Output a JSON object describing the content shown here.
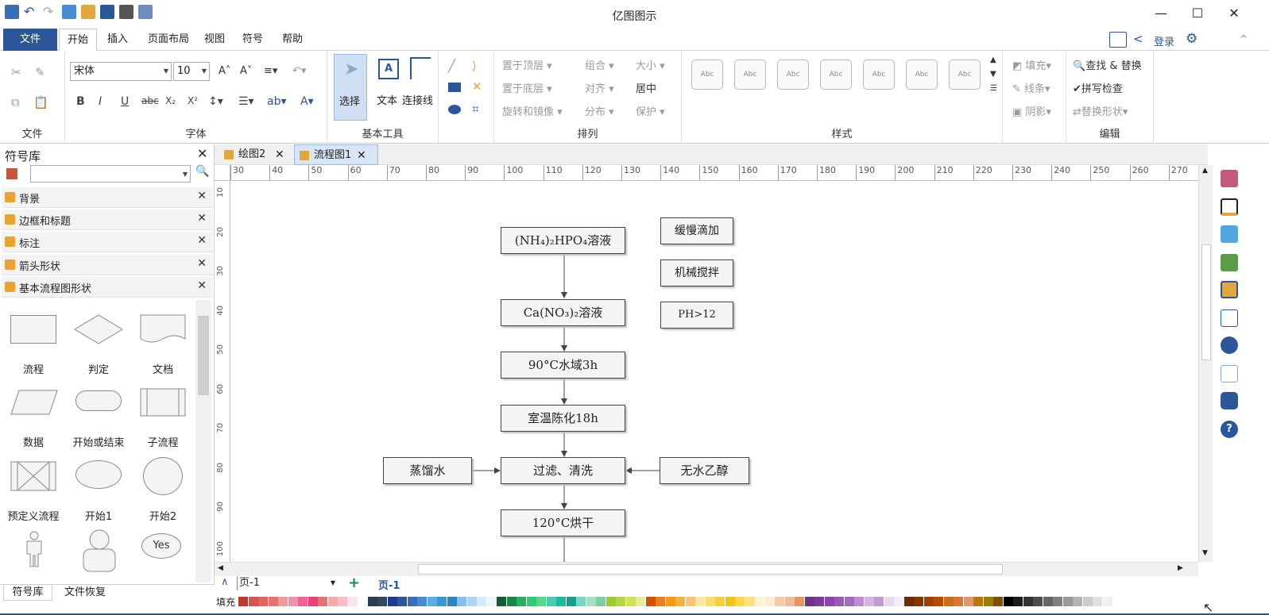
{
  "app": {
    "title": "亿图图示"
  },
  "window_controls": {
    "minimize": "—",
    "maximize": "☐",
    "close": "✕"
  },
  "menu": {
    "file": "文件",
    "items": [
      "开始",
      "插入",
      "页面布局",
      "视图",
      "符号",
      "帮助"
    ],
    "login": "登录"
  },
  "ribbon": {
    "font_name": "宋体",
    "font_size": "10",
    "file_group": "文件",
    "font_group": "字体",
    "basic_tools": {
      "label": "基本工具",
      "select": "选择",
      "text": "文本",
      "connector": "连接线"
    },
    "arrange": {
      "label": "排列",
      "bring_front": "置于顶层",
      "send_back": "置于底层",
      "rotate_mirror": "旋转和镜像",
      "group": "组合",
      "align": "对齐",
      "distribute": "分布",
      "size": "大小",
      "center": "居中",
      "protect": "保护"
    },
    "styles": {
      "label": "样式",
      "sample": "Abc",
      "fill": "填充",
      "line": "线条",
      "shadow": "阴影"
    },
    "edit": {
      "label": "编辑",
      "find_replace": "查找 & 替换",
      "spell_check": "拼写检查",
      "replace_shape": "替换形状"
    }
  },
  "library": {
    "title": "符号库",
    "categories": [
      "背景",
      "边框和标题",
      "标注",
      "箭头形状",
      "基本流程图形状"
    ],
    "shapes": [
      "流程",
      "判定",
      "文档",
      "数据",
      "开始或结束",
      "子流程",
      "预定义流程",
      "开始1",
      "开始2"
    ],
    "yes_label": "Yes",
    "bottom_tabs": [
      "符号库",
      "文件恢复"
    ]
  },
  "doc_tabs": [
    "绘图2",
    "流程图1"
  ],
  "ruler": {
    "h": [
      "30",
      "40",
      "50",
      "60",
      "70",
      "80",
      "90",
      "100",
      "110",
      "120",
      "130",
      "140",
      "150",
      "160",
      "170",
      "180",
      "190",
      "200",
      "210",
      "220",
      "230",
      "240",
      "250",
      "260",
      "270"
    ],
    "v": [
      "10",
      "20",
      "30",
      "40",
      "50",
      "60",
      "70",
      "80",
      "90",
      "100"
    ]
  },
  "flowchart": {
    "main": [
      "(NH₄)₂HPO₄溶液",
      "Ca(NO₃)₂溶液",
      "90°C水域3h",
      "室温陈化18h",
      "过滤、清洗",
      "120°C烘干"
    ],
    "left": "蒸馏水",
    "right": "无水乙醇",
    "notes": [
      "缓慢滴加",
      "机械搅拌",
      "PH>12"
    ]
  },
  "pages": {
    "current": "页-1",
    "tab": "页-1"
  },
  "fill_label": "填充"
}
